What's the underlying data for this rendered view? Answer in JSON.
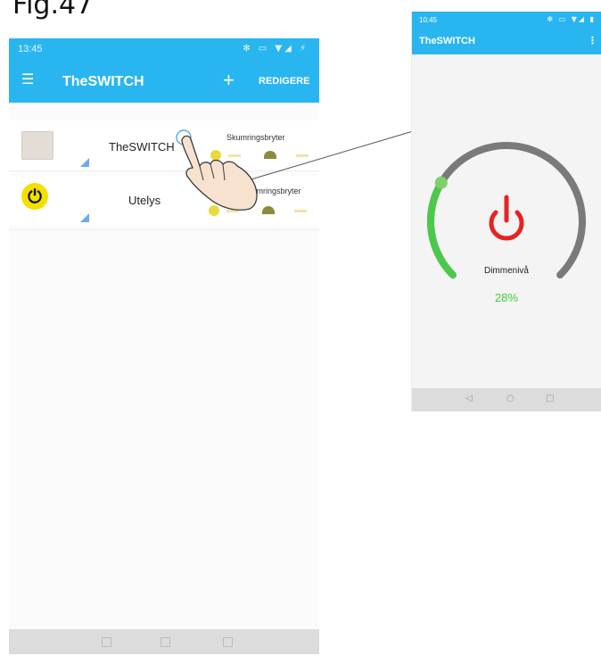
{
  "figure_label": "Fig.47",
  "left_phone": {
    "status": {
      "time": "13:45",
      "icons": "✻ ▭ ▼◢ ⚡"
    },
    "appbar": {
      "menu_glyph": "☰",
      "title": "TheSWITCH",
      "add_glyph": "+",
      "edit_label": "REDIGERE"
    },
    "devices": [
      {
        "name": "TheSWITCH",
        "mode": "Skumringsbryter"
      },
      {
        "name": "Utelys",
        "mode": "Skumringsbryter",
        "icon_glyph": "⏻"
      }
    ]
  },
  "right_phone": {
    "status": {
      "time": "10:45",
      "icons": "✻ ▭ ▼◢ ▮"
    },
    "appbar": {
      "title": "TheSWITCH",
      "more_glyph": "⋮"
    },
    "dimmer": {
      "label": "Dimmenivå",
      "value_text": "28%",
      "value": 0.28
    },
    "nav": {
      "back": "◁",
      "home": "○",
      "recent": "□"
    }
  },
  "colors": {
    "appbar": "#29b6f0",
    "dial_active": "#4cc94a",
    "dial_track": "#7a7a7a",
    "power_button": "#e52421",
    "value_text": "#3ad13a"
  }
}
